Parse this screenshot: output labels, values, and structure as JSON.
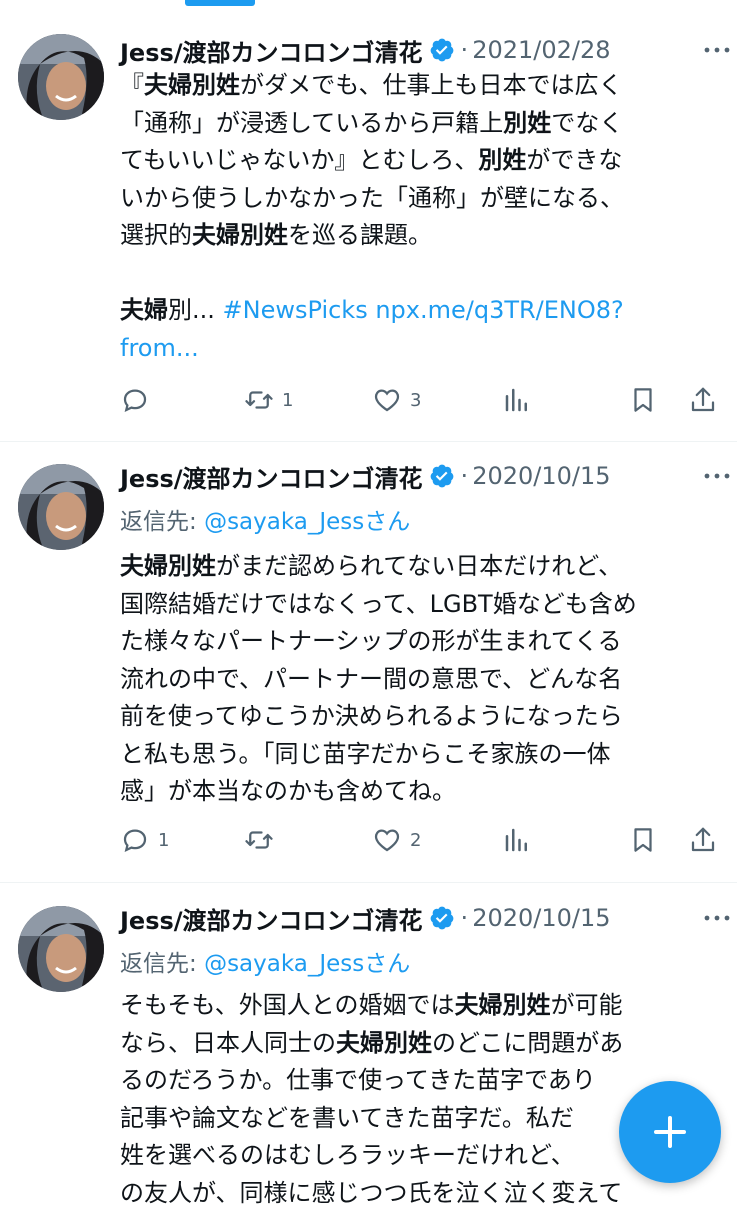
{
  "colors": {
    "accent": "#1d9bf0",
    "muted": "#536471",
    "text": "#0f1419"
  },
  "tweets": [
    {
      "author": "Jess/渡部カンコロンゴ清花",
      "date": "2021/02/28",
      "text": {
        "l1a": "『",
        "l1b": "夫婦別姓",
        "l1c": "がダメでも、仕事上も日本では広く",
        "l2a": "「通称」が浸透しているから戸籍上",
        "l2b": "別姓",
        "l2c": "でなく",
        "l3a": "てもいいじゃないか』とむしろ、",
        "l3b": "別姓",
        "l3c": "ができな",
        "l4": "いから使うしかなかった「通称」が壁になる、",
        "l5a": "選択的",
        "l5b": "夫婦別姓",
        "l5c": "を巡る課題。",
        "l6a": "夫婦",
        "l6b": "別...",
        "l6c": "#NewsPicks npx.me/q3TR/ENO8?",
        "l7": "from..."
      },
      "actions": {
        "reply": "",
        "retweet": "1",
        "like": "3"
      }
    },
    {
      "author": "Jess/渡部カンコロンゴ清花",
      "date": "2020/10/15",
      "reply_prefix": "返信先: ",
      "reply_handle": "@sayaka_Jessさん",
      "text": {
        "l1a": "夫婦別姓",
        "l1b": "がまだ認められてない日本だけれど、",
        "l2": "国際結婚だけではなくって、LGBT婚なども含め",
        "l3": "た様々なパートナーシップの形が生まれてくる",
        "l4": "流れの中で、パートナー間の意思で、どんな名",
        "l5": "前を使ってゆこうか決められるようになったら",
        "l6": "と私も思う。「同じ苗字だからこそ家族の一体",
        "l7": "感」が本当なのかも含めてね。"
      },
      "actions": {
        "reply": "1",
        "retweet": "",
        "like": "2"
      }
    },
    {
      "author": "Jess/渡部カンコロンゴ清花",
      "date": "2020/10/15",
      "reply_prefix": "返信先: ",
      "reply_handle": "@sayaka_Jessさん",
      "text": {
        "l1a": "そもそも、外国人との婚姻では",
        "l1b": "夫婦別姓",
        "l1c": "が可能",
        "l2a": "なら、日本人同士の",
        "l2b": "夫婦別姓",
        "l2c": "のどこに問題があ",
        "l3": "るのだろうか。仕事で使ってきた苗字であり",
        "l4": "記事や論文などを書いてきた苗字だ。私だ",
        "l5": "姓を選べるのはむしろラッキーだけれど、",
        "l6": "の友人が、同様に感じつつ氏を泣く泣く変えて"
      }
    }
  ],
  "fab": {
    "icon": "plus-icon"
  }
}
